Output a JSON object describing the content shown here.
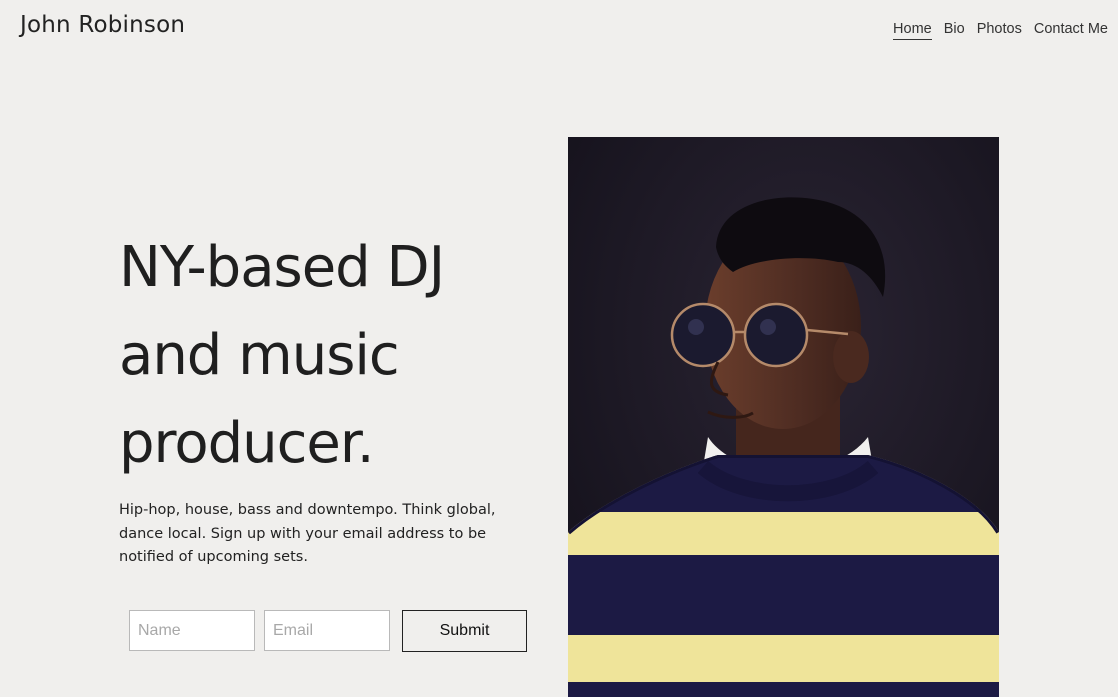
{
  "header": {
    "site_title": "John Robinson",
    "nav": [
      {
        "label": "Home",
        "active": true
      },
      {
        "label": "Bio",
        "active": false
      },
      {
        "label": "Photos",
        "active": false
      },
      {
        "label": "Contact Me",
        "active": false
      }
    ]
  },
  "hero": {
    "headline_lines": [
      "NY-based DJ",
      "and music",
      "producer."
    ],
    "description": "Hip-hop, house, bass and downtempo. Think global, dance local. Sign up with your email address to be notified of upcoming sets.",
    "form": {
      "name_placeholder": "Name",
      "email_placeholder": "Email",
      "submit_label": "Submit"
    },
    "photo": {
      "colors": {
        "background": "#1e1a26",
        "skin": "#5a3426",
        "sweater_navy": "#1c1a44",
        "sweater_yellow": "#efe49a"
      }
    }
  }
}
